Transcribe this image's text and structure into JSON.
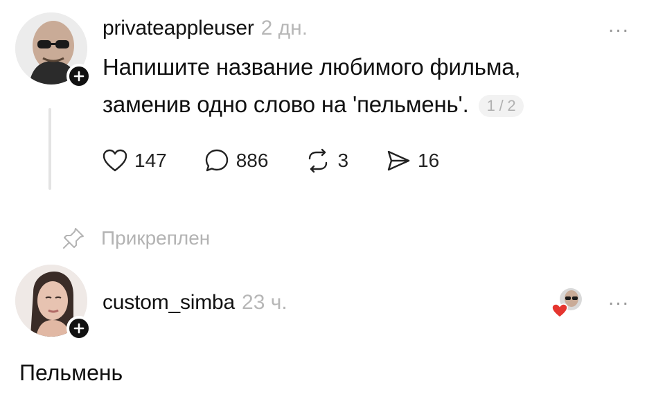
{
  "post": {
    "username": "privateappleuser",
    "time": "2 дн.",
    "text_line1": "Напишите название любимого фильма,",
    "text_line2": "заменив одно слово на 'пельмень'.",
    "page_indicator": "1 / 2",
    "more": "...",
    "actions": {
      "likes": "147",
      "comments": "886",
      "reposts": "3",
      "shares": "16"
    },
    "icons": {
      "avatar_badge": "plus-icon",
      "like": "heart-icon",
      "comment": "comment-bubble-icon",
      "repost": "repost-icon",
      "share": "send-icon"
    }
  },
  "pinned": {
    "label": "Прикреплен",
    "icon": "pin-icon"
  },
  "reply": {
    "username": "custom_simba",
    "time": "23 ч.",
    "more": "...",
    "text": "Пельмень",
    "liked_by_author": "heart-badge-avatar-icon"
  },
  "colors": {
    "text": "#111111",
    "muted": "#b7b7b7",
    "heart": "#e5352f",
    "line": "#e3e3e3"
  }
}
